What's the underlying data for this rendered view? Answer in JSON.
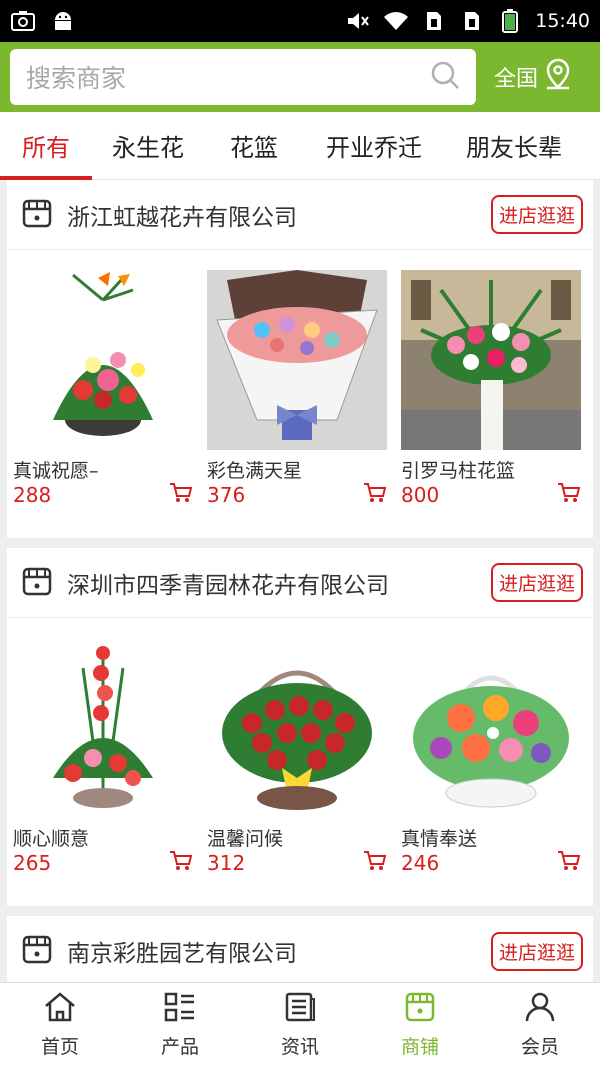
{
  "status": {
    "time": "15:40"
  },
  "search": {
    "placeholder": "搜索商家",
    "region": "全国"
  },
  "tabs": [
    "所有",
    "永生花",
    "花篮",
    "开业乔迁",
    "朋友长辈"
  ],
  "stores": [
    {
      "name": "浙江虹越花卉有限公司",
      "enter_label": "进店逛逛",
      "products": [
        {
          "name": "真诚祝愿–",
          "price": "288"
        },
        {
          "name": "彩色满天星",
          "price": "376"
        },
        {
          "name": "引罗马柱花篮",
          "price": "800"
        }
      ]
    },
    {
      "name": "深圳市四季青园林花卉有限公司",
      "enter_label": "进店逛逛",
      "products": [
        {
          "name": "顺心顺意",
          "price": "265"
        },
        {
          "name": "温馨问候",
          "price": "312"
        },
        {
          "name": "真情奉送",
          "price": "246"
        }
      ]
    },
    {
      "name": "南京彩胜园艺有限公司",
      "enter_label": "进店逛逛",
      "products": []
    }
  ],
  "bottom_nav": [
    {
      "label": "首页",
      "icon": "home-icon"
    },
    {
      "label": "产品",
      "icon": "grid-list-icon"
    },
    {
      "label": "资讯",
      "icon": "news-icon"
    },
    {
      "label": "商铺",
      "icon": "shop-icon"
    },
    {
      "label": "会员",
      "icon": "user-icon"
    }
  ],
  "colors": {
    "brand_green": "#7cb82f",
    "accent_red": "#d81e1e"
  }
}
